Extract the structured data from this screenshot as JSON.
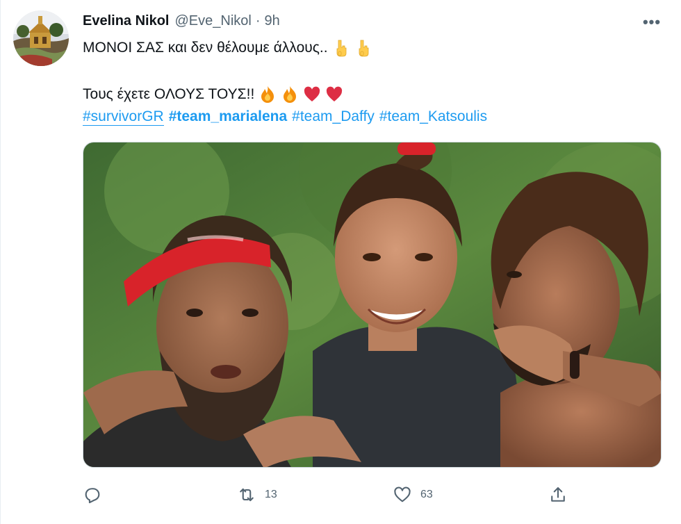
{
  "tweet": {
    "author": {
      "name": "Evelina Nikol",
      "handle": "@Eve_Nikol",
      "separator": "·",
      "time": "9h",
      "avatar_icon": "avatar-church-photo"
    },
    "more_icon": "more-options-icon",
    "more_label": "•••",
    "text": {
      "line1": "ΜΟΝΟΙ ΣΑΣ και δεν θέλουμε άλλους..",
      "line1_emoji": [
        "pointing-down-emoji",
        "pointing-down-emoji"
      ],
      "line2": "Τους έχετε ΟΛΟΥΣ ΤΟΥΣ!!",
      "line2_emoji": [
        "fire-emoji",
        "fire-emoji",
        "red-heart-emoji",
        "red-heart-emoji"
      ]
    },
    "hashtags": [
      {
        "text": "#survivorGR"
      },
      {
        "text": "#team_marialena"
      },
      {
        "text": "#team_Daffy"
      },
      {
        "text": "#team_Katsoulis"
      }
    ],
    "media": {
      "type": "photo",
      "alt_icon": "photo-three-people-embracing"
    },
    "actions": {
      "reply": {
        "icon": "reply-icon",
        "count": ""
      },
      "retweet": {
        "icon": "retweet-icon",
        "count": "13"
      },
      "like": {
        "icon": "heart-icon",
        "count": "63"
      },
      "share": {
        "icon": "share-icon",
        "count": ""
      }
    },
    "colors": {
      "link": "#1d9bf0",
      "secondary_text": "#536471",
      "primary_text": "#0f1419",
      "heart_emoji": "#dd2e44",
      "headband": "#d8232a"
    }
  }
}
